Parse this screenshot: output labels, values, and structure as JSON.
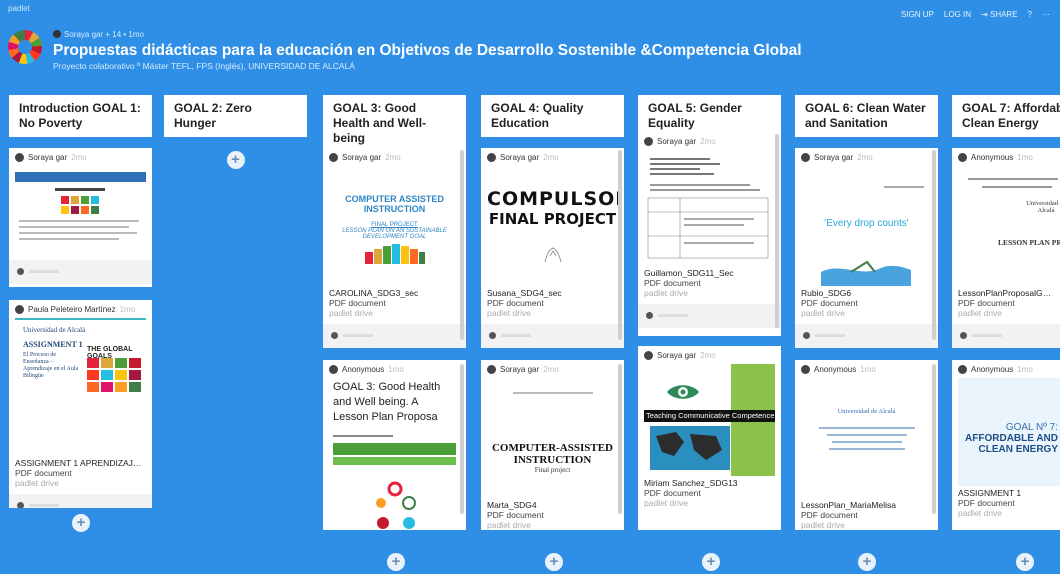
{
  "header": {
    "app_name": "padlet",
    "author_line": "Soraya gar + 14 • 1mo",
    "title": "Propuestas didácticas para la educación en Objetivos de Desarrollo Sostenible &Competencia Global",
    "subtitle": "Proyecto colaborativo º Máster TEFL, FPS (Inglés), UNIVERSIDAD DE ALCALÁ",
    "nav": {
      "signup": "SIGN UP",
      "login": "LOG IN",
      "share": "SHARE",
      "help": "?",
      "more": "···"
    }
  },
  "add_symbol": "+",
  "columns": [
    {
      "title": "Introduction GOAL 1: No Poverty"
    },
    {
      "title": "GOAL 2: Zero Hunger"
    },
    {
      "title": "GOAL 3: Good Health and Well-being"
    },
    {
      "title": "GOAL 4: Quality Education"
    },
    {
      "title": "GOAL 5: Gender Equality"
    },
    {
      "title": "GOAL 6: Clean Water and Sanitation"
    },
    {
      "title": "GOAL 7: Affordable and Clean Energy"
    }
  ],
  "cards": {
    "c1a": {
      "author": "Soraya gar",
      "time": "2mo"
    },
    "c1b": {
      "author": "Paula Peleteiro Martínez",
      "time": "1mo",
      "file": "ASSIGNMENT 1 APRENDIZAJE EN EL A...",
      "type": "PDF document",
      "source": "padlet drive",
      "preview_lines": [
        "Universidad de Alcalá",
        "ASSIGNMENT 1",
        "El Proceso de Enseñanza – Aprendizaje en el Aula Bilingüe",
        "THE GLOBAL GOALS"
      ]
    },
    "c3a": {
      "author": "Soraya gar",
      "time": "2mo",
      "file": "CAROLINA_SDG3_sec",
      "type": "PDF document",
      "source": "padlet drive",
      "preview_lines": [
        "COMPUTER ASSISTED",
        "INSTRUCTION",
        "FINAL PROJECT",
        "LESSON PLAN ON AN SUSTAINABLE",
        "DEVELOPMENT GOAL"
      ]
    },
    "c3b": {
      "author": "Anonymous",
      "time": "1mo",
      "title": "GOAL 3: Good Health and Well being. A Lesson Plan Proposa"
    },
    "c4a": {
      "author": "Soraya gar",
      "time": "2mo",
      "file": "Susana_SDG4_sec",
      "type": "PDF document",
      "source": "padlet drive",
      "preview_lines": [
        "COMPULSORY",
        "FINAL PROJECT"
      ]
    },
    "c4b": {
      "author": "Soraya gar",
      "time": "2mo",
      "file": "Marta_SDG4",
      "type": "PDF document",
      "source": "padlet drive",
      "preview_lines": [
        "COMPUTER-ASSISTED",
        "INSTRUCTION",
        "Final project"
      ]
    },
    "c5a": {
      "author": "Soraya gar",
      "time": "2mo",
      "file": "Guillamon_SDG11_Sec",
      "type": "PDF document",
      "source": "padlet drive",
      "preview_lines": [
        "Final Project",
        "Lesson Plan"
      ]
    },
    "c5b": {
      "author": "Soraya gar",
      "time": "2mo",
      "file": "Miriam Sanchez_SDG13",
      "type": "PDF document",
      "source": "padlet drive",
      "preview_lines": [
        "Teaching Communicative Competence with Tr"
      ]
    },
    "c6a": {
      "author": "Soraya gar",
      "time": "2mo",
      "file": "Rubio_SDG6",
      "type": "PDF document",
      "source": "padlet drive",
      "preview_lines": [
        "'Every drop counts'"
      ]
    },
    "c6b": {
      "author": "Anonymous",
      "time": "1mo",
      "file": "LessonPlan_MariaMelisa",
      "type": "PDF document",
      "source": "padlet drive",
      "preview_lines": [
        "Universidad de Alcalá"
      ]
    },
    "c7a": {
      "author": "Anonymous",
      "time": "1mo",
      "file": "LessonPlanProposalGeorgiana",
      "type": "PDF document",
      "source": "padlet drive",
      "preview_lines": [
        "Universidad de Alcalá",
        "LESSON PLAN PROPOSAL"
      ]
    },
    "c7b": {
      "author": "Anonymous",
      "time": "1mo",
      "file": "ASSIGNMENT 1",
      "type": "PDF document",
      "source": "padlet drive",
      "preview_lines": [
        "GOAL Nº 7:",
        "AFFORDABLE AND",
        "CLEAN ENERGY"
      ]
    }
  },
  "colors": {
    "background": "#2f8fe6",
    "card": "#ffffff",
    "accent_red": "#c5192d",
    "sdg_green": "#4c9f38"
  }
}
